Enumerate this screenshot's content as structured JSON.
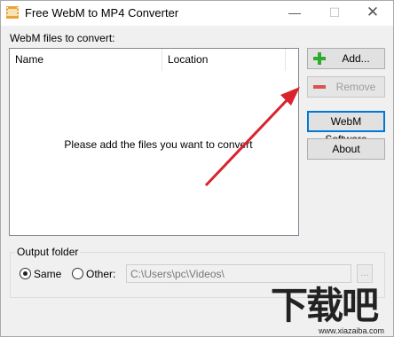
{
  "window": {
    "title": "Free WebM to MP4 Converter",
    "min_glyph": "—",
    "max_glyph": "☐",
    "close_glyph": "✕"
  },
  "files": {
    "label": "WebM files to convert:",
    "columns": [
      "Name",
      "Location"
    ],
    "empty_message": "Please add the files you want to convert"
  },
  "buttons": {
    "add": "Add...",
    "remove": "Remove",
    "webm_software": "WebM Software",
    "about": "About"
  },
  "output": {
    "group_title": "Output folder",
    "same_label": "Same",
    "other_label": "Other:",
    "selected": "Same",
    "path_value": "C:\\Users\\pc\\Videos\\",
    "browse_label": "..."
  },
  "watermark": {
    "logo": "下载吧",
    "url": "www.xiazaiba.com"
  },
  "colors": {
    "accent": "#0078d7",
    "arrow": "#d9232d",
    "add_icon": "#2eaa2e",
    "remove_icon": "#d9534f"
  }
}
